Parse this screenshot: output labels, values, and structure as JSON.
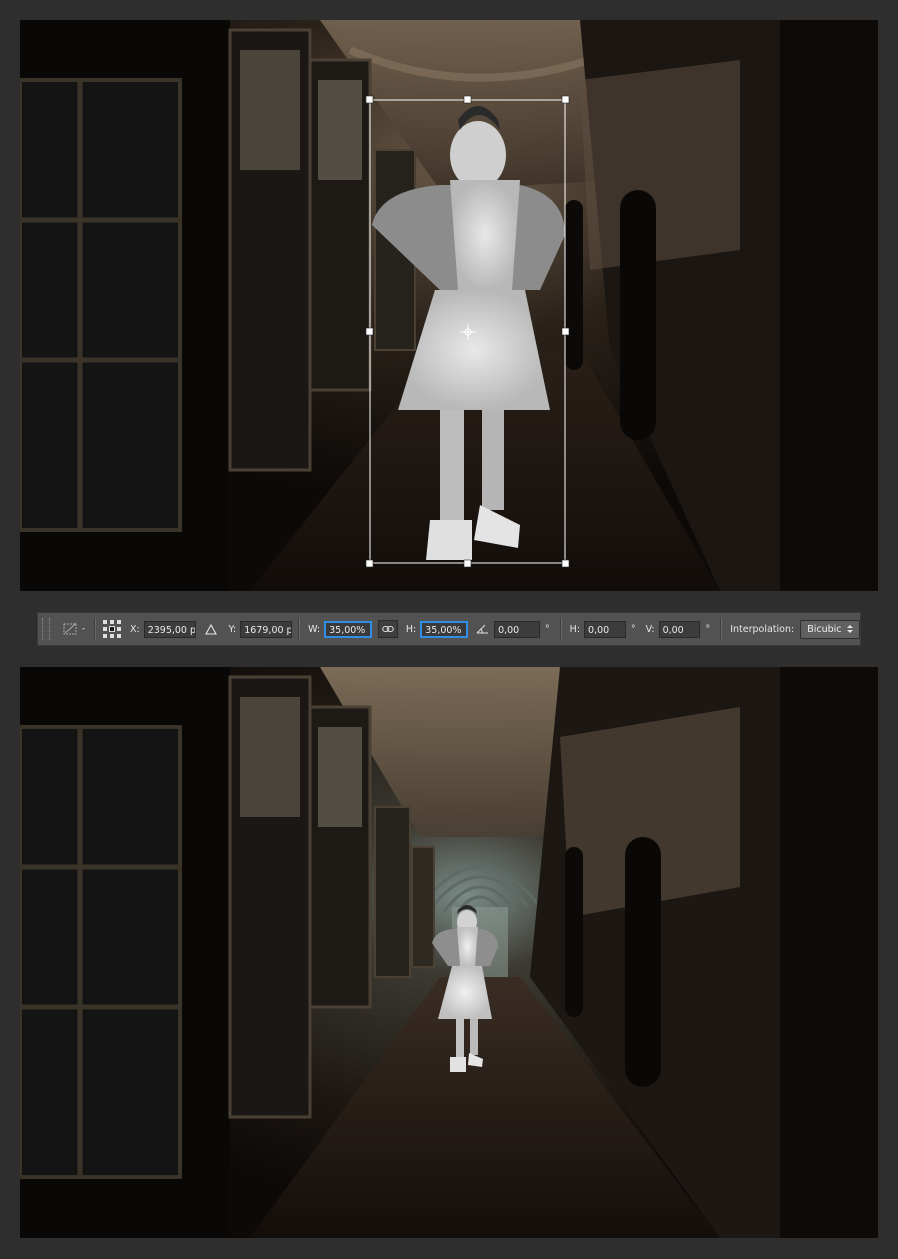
{
  "options_bar": {
    "x_label": "X:",
    "x_value": "2395,00 p:",
    "y_label": "Y:",
    "y_value": "1679,00 p:",
    "w_label": "W:",
    "w_value": "35,00%",
    "h_label": "H:",
    "h_value": "35,00%",
    "angle_value": "0,00",
    "angle_unit": "°",
    "hskew_label": "H:",
    "hskew_value": "0,00",
    "hskew_unit": "°",
    "vskew_label": "V:",
    "vskew_value": "0,00",
    "vskew_unit": "°",
    "interpolation_label": "Interpolation:",
    "interpolation_value": "Bicubic"
  },
  "icons": {
    "transform_tool": "transform-tool-icon",
    "reference_point": "reference-point-grid-icon",
    "relative_positioning": "delta-triangle-icon",
    "link": "chain-link-icon",
    "rotate": "angle-icon",
    "dropdown": "updown-arrows-icon"
  },
  "colors": {
    "focus_accent": "#2f8fe6",
    "panel_bg": "#525252",
    "app_bg": "#2e2e2e"
  }
}
